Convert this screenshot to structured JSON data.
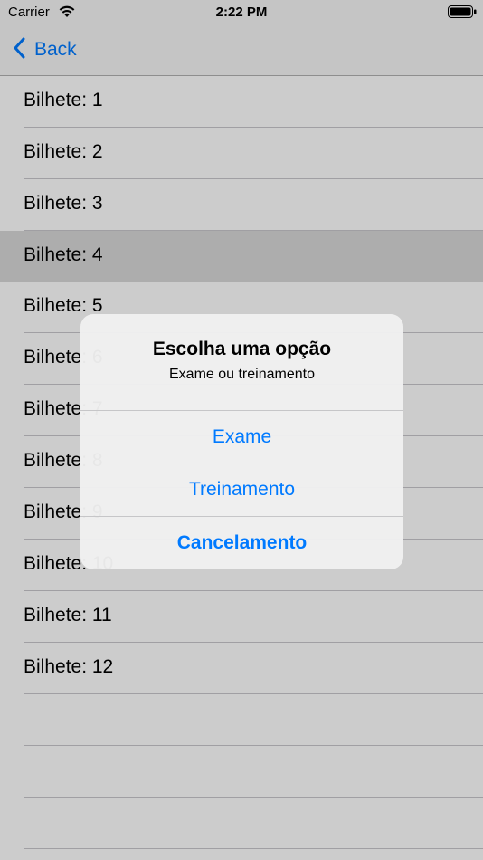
{
  "status_bar": {
    "carrier": "Carrier",
    "time": "2:22 PM"
  },
  "nav": {
    "back_label": "Back"
  },
  "tickets": [
    {
      "label": "Bilhete: 1"
    },
    {
      "label": "Bilhete: 2"
    },
    {
      "label": "Bilhete: 3"
    },
    {
      "label": "Bilhete: 4",
      "selected": true
    },
    {
      "label": "Bilhete: 5"
    },
    {
      "label": "Bilhete: 6"
    },
    {
      "label": "Bilhete: 7"
    },
    {
      "label": "Bilhete: 8"
    },
    {
      "label": "Bilhete: 9"
    },
    {
      "label": "Bilhete: 10"
    },
    {
      "label": "Bilhete: 11"
    },
    {
      "label": "Bilhete: 12"
    }
  ],
  "alert": {
    "title": "Escolha uma opção",
    "message": "Exame ou treinamento",
    "actions": [
      {
        "label": "Exame"
      },
      {
        "label": "Treinamento"
      },
      {
        "label": "Cancelamento",
        "bold": true
      }
    ]
  },
  "colors": {
    "accent": "#007aff",
    "selected_row": "#d9d9d9"
  }
}
